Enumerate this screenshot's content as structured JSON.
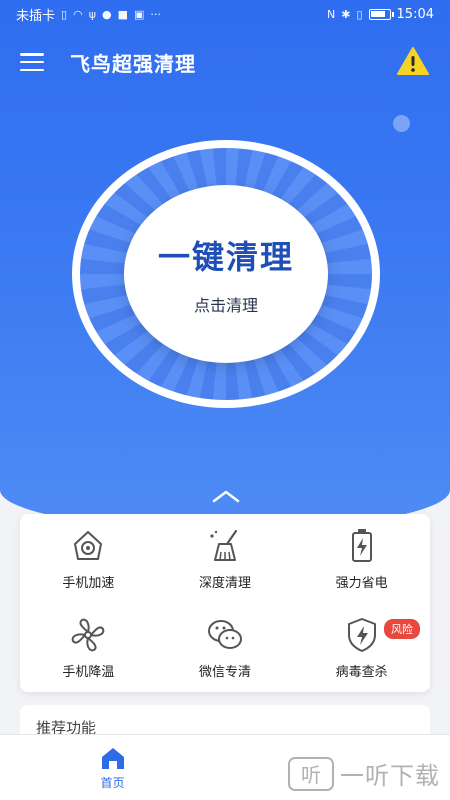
{
  "status_bar": {
    "carrier": "未插卡",
    "time": "15:04",
    "battery_level": 0.8
  },
  "app_bar": {
    "title": "飞鸟超强清理"
  },
  "clean_button": {
    "main_label": "一键清理",
    "sub_label": "点击清理"
  },
  "functions": [
    {
      "label": "手机加速",
      "icon": "speedometer-icon"
    },
    {
      "label": "深度清理",
      "icon": "broom-icon"
    },
    {
      "label": "强力省电",
      "icon": "battery-bolt-icon"
    },
    {
      "label": "手机降温",
      "icon": "fan-icon"
    },
    {
      "label": "微信专清",
      "icon": "wechat-icon"
    },
    {
      "label": "病毒查杀",
      "icon": "shield-bolt-icon",
      "badge": "风险"
    }
  ],
  "recommend": {
    "title": "推荐功能"
  },
  "bottom_nav": {
    "home_label": "首页"
  },
  "watermark": {
    "text": "一听下载",
    "logo_caption": "听"
  },
  "colors": {
    "primary": "#2f6df0",
    "accent_text": "#1e4fb6",
    "badge": "#e8483e",
    "warning": "#f5d327"
  }
}
